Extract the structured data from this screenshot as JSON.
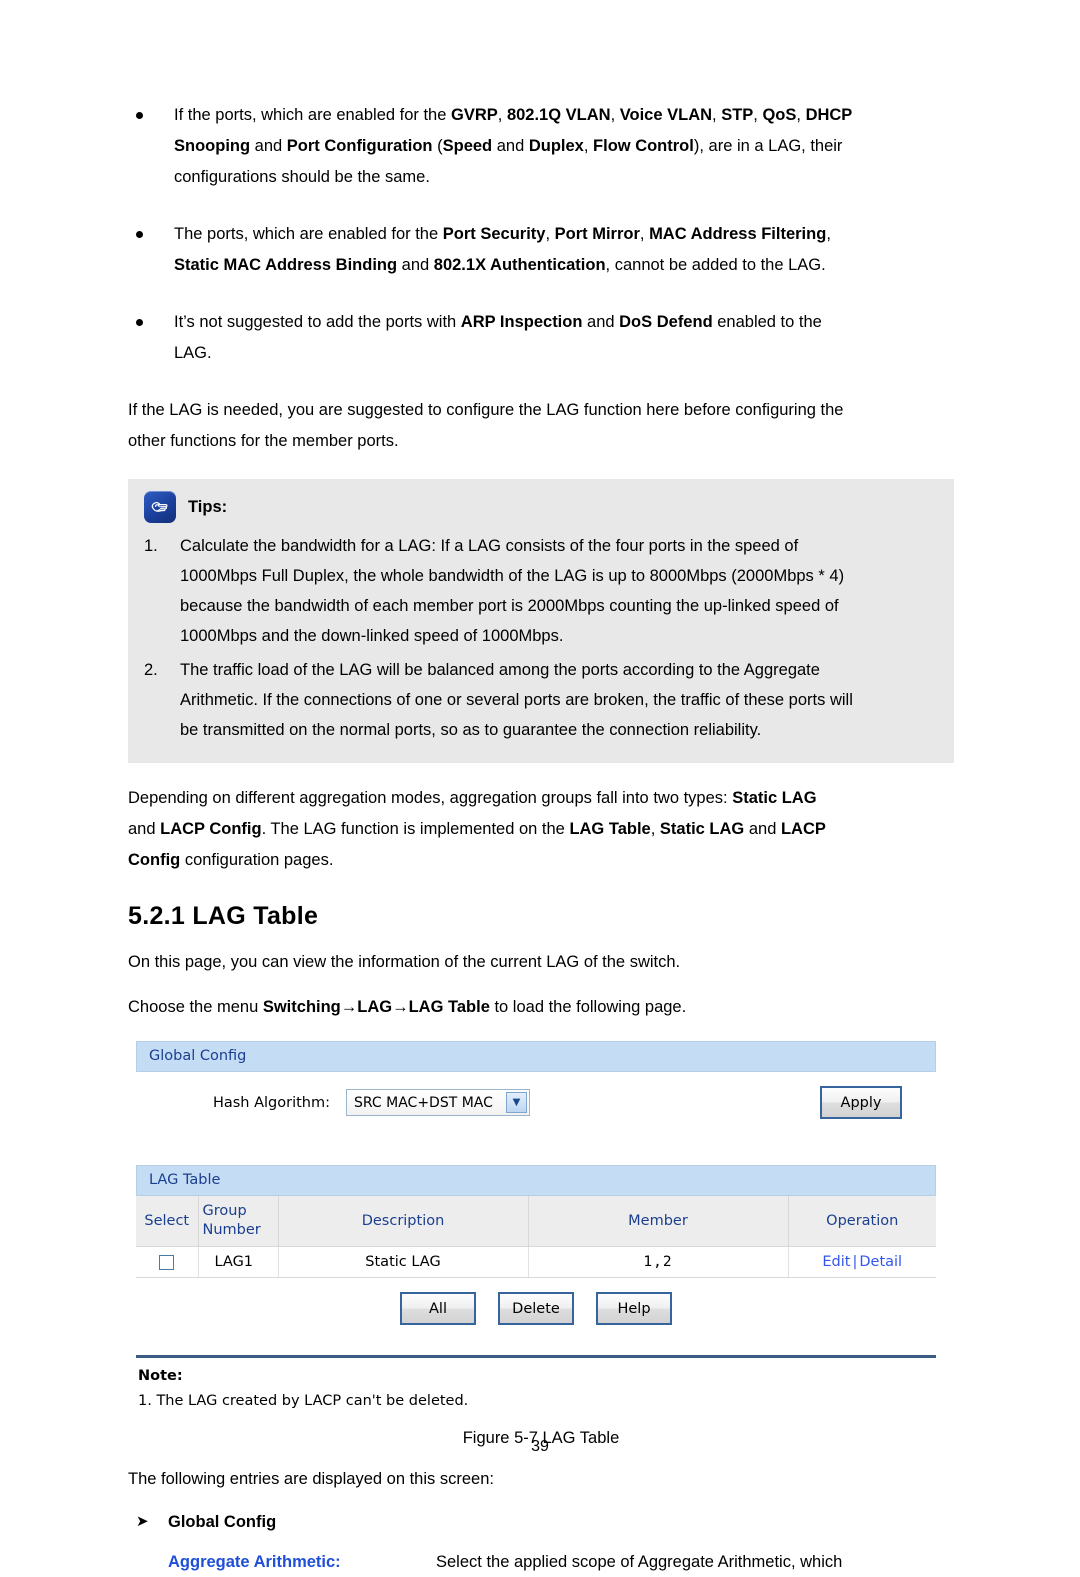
{
  "document": {
    "page_number": "39",
    "bullets": [
      {
        "id": "bullet-gvrp",
        "lines": [
          [
            {
              "t": "If the ports, which are enabled for the ",
              "b": false
            },
            {
              "t": "GVRP",
              "b": true
            },
            {
              "t": ", ",
              "b": false
            },
            {
              "t": "802.1Q VLAN",
              "b": true
            },
            {
              "t": ", ",
              "b": false
            },
            {
              "t": "Voice VLAN",
              "b": true
            },
            {
              "t": ", ",
              "b": false
            },
            {
              "t": "STP",
              "b": true
            },
            {
              "t": ", ",
              "b": false
            },
            {
              "t": "QoS",
              "b": true
            },
            {
              "t": ", ",
              "b": false
            },
            {
              "t": "DHCP",
              "b": true
            }
          ],
          [
            {
              "t": "Snooping",
              "b": true
            },
            {
              "t": " and ",
              "b": false
            },
            {
              "t": "Port Configuration",
              "b": true
            },
            {
              "t": " (",
              "b": false
            },
            {
              "t": "Speed",
              "b": true
            },
            {
              "t": " and ",
              "b": false
            },
            {
              "t": "Duplex",
              "b": true
            },
            {
              "t": ", ",
              "b": false
            },
            {
              "t": "Flow Control",
              "b": true
            },
            {
              "t": "), are in a LAG, their",
              "b": false
            }
          ],
          [
            {
              "t": "configurations should be the same.",
              "b": false
            }
          ]
        ]
      },
      {
        "id": "bullet-port-security",
        "lines": [
          [
            {
              "t": "The ports, which are enabled for the ",
              "b": false
            },
            {
              "t": "Port Security",
              "b": true
            },
            {
              "t": ", ",
              "b": false
            },
            {
              "t": "Port Mirror",
              "b": true
            },
            {
              "t": ", ",
              "b": false
            },
            {
              "t": "MAC Address Filtering",
              "b": true
            },
            {
              "t": ",",
              "b": false
            }
          ],
          [
            {
              "t": "Static MAC Address Binding",
              "b": true
            },
            {
              "t": " and ",
              "b": false
            },
            {
              "t": "802.1X Authentication",
              "b": true
            },
            {
              "t": ", cannot be added to the LAG.",
              "b": false
            }
          ]
        ]
      },
      {
        "id": "bullet-arp-inspection",
        "lines": [
          [
            {
              "t": "It’s not suggested to add the ports with ",
              "b": false
            },
            {
              "t": "ARP Inspection",
              "b": true
            },
            {
              "t": " and ",
              "b": false
            },
            {
              "t": "DoS Defend",
              "b": true
            },
            {
              "t": " enabled to the",
              "b": false
            }
          ],
          [
            {
              "t": "LAG.",
              "b": false
            }
          ]
        ]
      }
    ],
    "intro_paragraph": {
      "line1": "If the LAG is needed, you are suggested to configure the LAG function here before configuring the",
      "line2": "other functions for the member ports."
    },
    "tips": {
      "icon": "pointing-hand-icon",
      "title": "Tips:",
      "items": [
        {
          "number": "1.",
          "lines": [
            "Calculate the bandwidth for a LAG: If a LAG consists of the four ports in the speed of",
            "1000Mbps Full Duplex, the whole bandwidth of the LAG is up to 8000Mbps (2000Mbps * 4)",
            "because the bandwidth of each member port is 2000Mbps counting the up-linked speed of",
            "1000Mbps and the down-linked speed of 1000Mbps."
          ]
        },
        {
          "number": "2.",
          "lines": [
            "The traffic load of the LAG will be balanced among the ports according to the Aggregate",
            "Arithmetic. If the connections of one or several ports are broken, the traffic of these ports will",
            "be transmitted on the normal ports, so as to guarantee the connection reliability."
          ]
        }
      ]
    },
    "aggregation_paragraph": {
      "line1": [
        {
          "t": "Depending on different aggregation modes, aggregation groups fall into two types: ",
          "b": false
        },
        {
          "t": "Static LAG",
          "b": true
        }
      ],
      "line2": [
        {
          "t": "and ",
          "b": false
        },
        {
          "t": "LACP Config",
          "b": true
        },
        {
          "t": ". The LAG function is implemented on the ",
          "b": false
        },
        {
          "t": "LAG Table",
          "b": true
        },
        {
          "t": ", ",
          "b": false
        },
        {
          "t": "Static LAG",
          "b": true
        },
        {
          "t": " and ",
          "b": false
        },
        {
          "t": "LACP",
          "b": true
        }
      ],
      "line3": [
        {
          "t": "Config",
          "b": true
        },
        {
          "t": " configuration pages.",
          "b": false
        }
      ]
    },
    "section_heading": "5.2.1 LAG Table",
    "after_heading": {
      "line1": "On this page, you can view the information of the current LAG of the switch.",
      "line2": [
        {
          "t": "Choose the menu ",
          "b": false
        },
        {
          "t": "Switching→LAG→LAG Table",
          "b": true
        },
        {
          "t": " to load the following page.",
          "b": false
        }
      ]
    },
    "figure_caption": "Figure 5-7 LAG Table",
    "entries_intro": "The following entries are displayed on this screen:",
    "arrow_item": "Global Config",
    "definition": {
      "term": "Aggregate Arithmetic:",
      "description": "Select the applied scope of Aggregate Arithmetic, which"
    }
  },
  "screenshot": {
    "global_config": {
      "header": "Global Config",
      "hash_algorithm_label": "Hash Algorithm:",
      "hash_algorithm_value": "SRC MAC+DST MAC",
      "dropdown_arrow": "chevron-down-icon",
      "apply_button": "Apply"
    },
    "lag_table": {
      "header": "LAG Table",
      "columns": [
        "Select",
        "Group\nNumber",
        "Description",
        "Member",
        "Operation"
      ],
      "column_select": "Select",
      "column_group_line1": "Group",
      "column_group_line2": "Number",
      "column_description": "Description",
      "column_member": "Member",
      "column_operation": "Operation",
      "rows": [
        {
          "selected": false,
          "group_number": "LAG1",
          "description": "Static LAG",
          "member": "1,2",
          "op_edit": "Edit",
          "op_separator": "|",
          "op_detail": "Detail"
        }
      ],
      "buttons": [
        "All",
        "Delete",
        "Help"
      ],
      "button_all": "All",
      "button_delete": "Delete",
      "button_help": "Help",
      "note_title": "Note:",
      "note_line1": "1. The LAG created by LACP can't be deleted."
    },
    "colors": {
      "panel_header_bg": "#c5dcf5",
      "panel_header_text": "#1b3f8f",
      "table_header_bg": "#ededed",
      "link_blue": "#3355ee",
      "button_border": "#35659c",
      "note_divider": "#3b5c82",
      "tips_box_bg": "#e8e8e8",
      "definition_term": "#1f4fd8"
    }
  }
}
